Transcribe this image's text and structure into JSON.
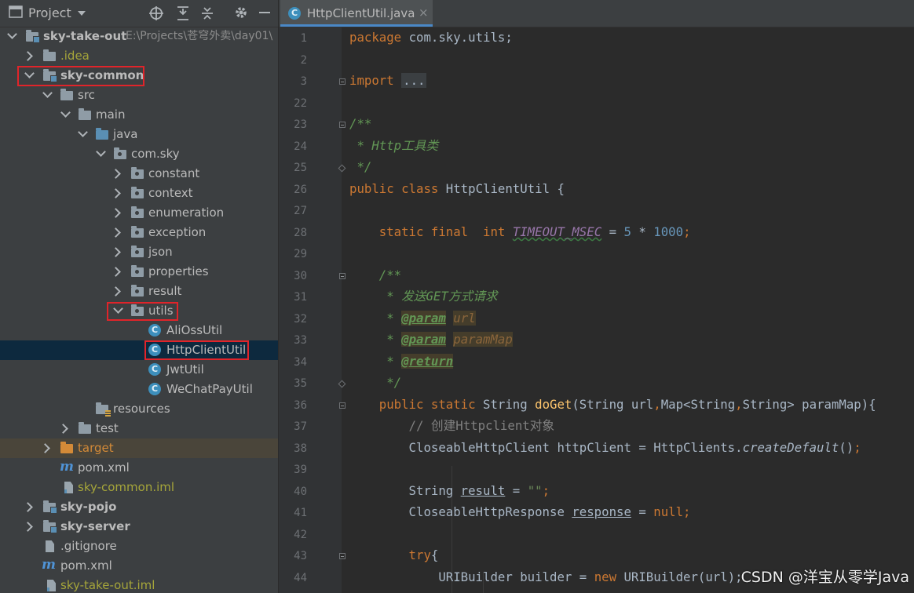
{
  "project_panel": {
    "title": "Project",
    "header_icons": [
      "window-icon",
      "dropdown-icon",
      "locate-icon",
      "expand-all-icon",
      "collapse-all-icon",
      "settings-icon",
      "minimize-icon"
    ],
    "tree": [
      {
        "label": "sky-take-out",
        "path": "E:\\Projects\\苍穹外卖\\day01\\",
        "kind": "module",
        "expanded": true
      },
      {
        "label": ".idea",
        "kind": "folder",
        "expanded": false
      },
      {
        "label": "sky-common",
        "kind": "module",
        "expanded": true
      },
      {
        "label": "src",
        "kind": "folder",
        "expanded": true
      },
      {
        "label": "main",
        "kind": "folder",
        "expanded": true
      },
      {
        "label": "java",
        "kind": "source-folder",
        "expanded": true
      },
      {
        "label": "com.sky",
        "kind": "package",
        "expanded": true
      },
      {
        "label": "constant",
        "kind": "package",
        "expanded": false
      },
      {
        "label": "context",
        "kind": "package",
        "expanded": false
      },
      {
        "label": "enumeration",
        "kind": "package",
        "expanded": false
      },
      {
        "label": "exception",
        "kind": "package",
        "expanded": false
      },
      {
        "label": "json",
        "kind": "package",
        "expanded": false
      },
      {
        "label": "properties",
        "kind": "package",
        "expanded": false
      },
      {
        "label": "result",
        "kind": "package",
        "expanded": false
      },
      {
        "label": "utils",
        "kind": "package",
        "expanded": true
      },
      {
        "label": "AliOssUtil",
        "kind": "class"
      },
      {
        "label": "HttpClientUtil",
        "kind": "class",
        "selected": true
      },
      {
        "label": "JwtUtil",
        "kind": "class"
      },
      {
        "label": "WeChatPayUtil",
        "kind": "class"
      },
      {
        "label": "resources",
        "kind": "resources-folder"
      },
      {
        "label": "test",
        "kind": "folder",
        "expanded": false
      },
      {
        "label": "target",
        "kind": "excluded-folder",
        "expanded": false
      },
      {
        "label": "pom.xml",
        "kind": "maven"
      },
      {
        "label": "sky-common.iml",
        "kind": "iml"
      },
      {
        "label": "sky-pojo",
        "kind": "module",
        "expanded": false
      },
      {
        "label": "sky-server",
        "kind": "module",
        "expanded": false
      },
      {
        "label": ".gitignore",
        "kind": "file"
      },
      {
        "label": "pom.xml",
        "kind": "maven"
      },
      {
        "label": "sky-take-out.iml",
        "kind": "iml"
      }
    ]
  },
  "editor": {
    "tab": {
      "label": "HttpClientUtil.java",
      "close": "×",
      "icon": "class-icon"
    },
    "line_numbers": [
      "1",
      "2",
      "3",
      "22",
      "23",
      "24",
      "25",
      "26",
      "27",
      "28",
      "29",
      "30",
      "31",
      "32",
      "33",
      "34",
      "35",
      "36",
      "37",
      "38",
      "39",
      "40",
      "41",
      "42",
      "43",
      "44"
    ],
    "code": {
      "l1_kw": "package",
      "l1_rest": " com.sky.utils;",
      "l3_kw": "import",
      "l3_dots": "...",
      "l23": "/**",
      "l24": " * Http工具类",
      "l25": " */",
      "l26_kw": "public class",
      "l26_rest": " HttpClientUtil {",
      "l28_kw": "    static final  int ",
      "l28_const": "TIMEOUT_MSEC",
      "l28_eq": " = ",
      "l28_n1": "5",
      "l28_mul": " * ",
      "l28_n2": "1000",
      "l28_semi": ";",
      "l30": "    /**",
      "l31": "     * 发送GET方式请求",
      "l32_pre": "     * ",
      "l32_tag": "@param",
      "l32_sp": " ",
      "l32_name": "url",
      "l33_pre": "     * ",
      "l33_tag": "@param",
      "l33_sp": " ",
      "l33_name": "paramMap",
      "l34_pre": "     * ",
      "l34_tag": "@return",
      "l35": "     */",
      "l36_kw": "    public static",
      "l36_type": " String ",
      "l36_fn": "doGet",
      "l36_p1": "(String url",
      "l36_c1": ",",
      "l36_p2": "Map<String",
      "l36_c2": ",",
      "l36_p3": "String> paramMap){",
      "l37": "        // 创建Httpclient对象",
      "l38_a": "        CloseableHttpClient httpClient = HttpClients.",
      "l38_fn": "createDefault",
      "l38_b": "()",
      "l38_semi": ";",
      "l40_a": "        String ",
      "l40_var": "result",
      "l40_b": " = ",
      "l40_str": "\"\"",
      "l40_semi": ";",
      "l41_a": "        CloseableHttpResponse ",
      "l41_var": "response",
      "l41_b": " = ",
      "l41_null": "null",
      "l41_semi": ";",
      "l43_kw": "        try",
      "l43_rest": "{",
      "l44_a": "            URIBuilder builder = ",
      "l44_new": "new",
      "l44_b": " URIBuilder(url);"
    }
  },
  "watermark": "CSDN @洋宝从零学Java",
  "colors": {
    "highlight_box": "#e0242a",
    "selection": "#0d293e",
    "keyword": "#cc7832",
    "doc_comment": "#629755"
  }
}
